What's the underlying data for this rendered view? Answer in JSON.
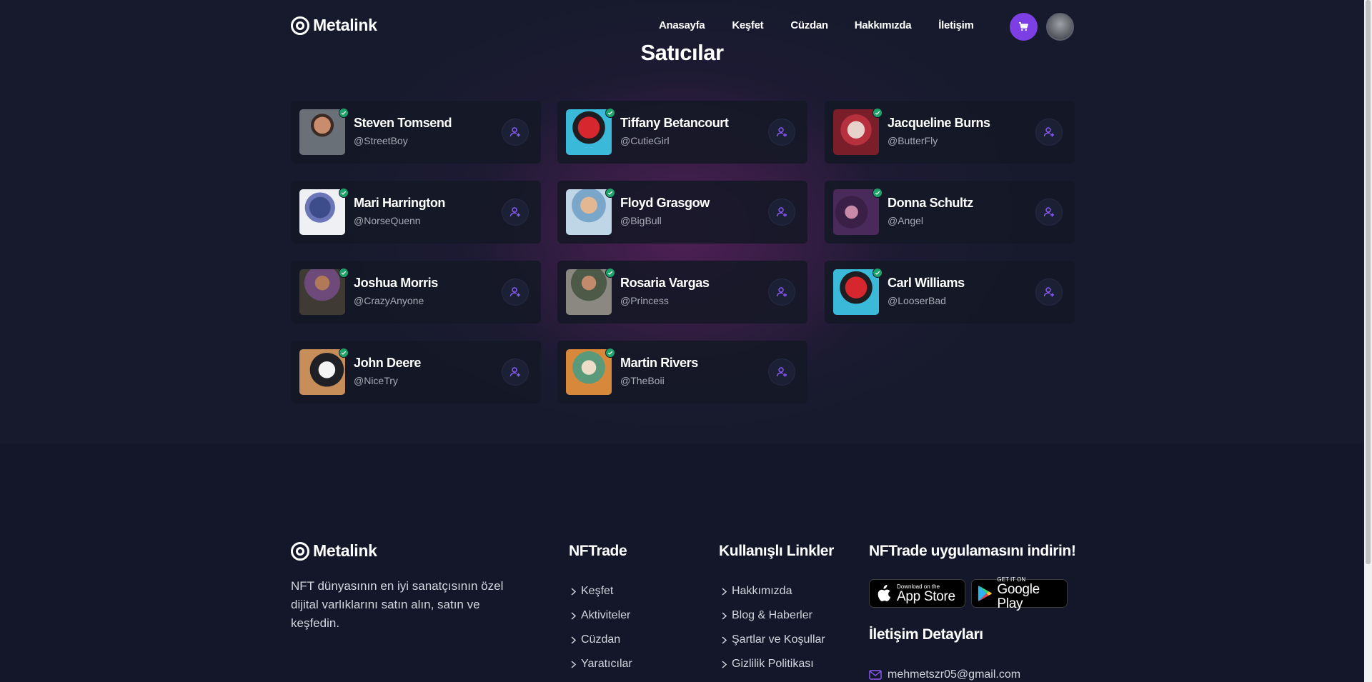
{
  "brand": {
    "name": "Metalink"
  },
  "nav": {
    "links": [
      "Anasayfa",
      "Keşfet",
      "Cüzdan",
      "Hakkımızda",
      "İletişim"
    ]
  },
  "colors": {
    "accent": "#7b3fe4",
    "verified": "#1ea46a",
    "background": "#14172a"
  },
  "sellers_section": {
    "title": "Satıcılar",
    "sellers": [
      {
        "name": "Steven Tomsend",
        "handle": "@StreetBoy"
      },
      {
        "name": "Tiffany Betancourt",
        "handle": "@CutieGirl"
      },
      {
        "name": "Jacqueline Burns",
        "handle": "@ButterFly"
      },
      {
        "name": "Mari Harrington",
        "handle": "@NorseQuenn"
      },
      {
        "name": "Floyd Grasgow",
        "handle": "@BigBull"
      },
      {
        "name": "Donna Schultz",
        "handle": "@Angel"
      },
      {
        "name": "Joshua Morris",
        "handle": "@CrazyAnyone"
      },
      {
        "name": "Rosaria Vargas",
        "handle": "@Princess"
      },
      {
        "name": "Carl Williams",
        "handle": "@LooserBad"
      },
      {
        "name": "John Deere",
        "handle": "@NiceTry"
      },
      {
        "name": "Martin Rivers",
        "handle": "@TheBoii"
      }
    ]
  },
  "footer": {
    "brand": "Metalink",
    "description": "NFT dünyasının en iyi sanatçısının özel dijital varlıklarını satın alın, satın ve keşfedin.",
    "nftrade": {
      "title": "NFTrade",
      "links": [
        "Keşfet",
        "Aktiviteler",
        "Cüzdan",
        "Yaratıcılar"
      ]
    },
    "useful_links": {
      "title": "Kullanışlı Linkler",
      "links": [
        "Hakkımızda",
        "Blog & Haberler",
        "Şartlar ve Koşullar",
        "Gizlilik Politikası"
      ]
    },
    "app": {
      "title": "NFTrade uygulamasını indirin!",
      "app_store_small": "Download on the",
      "app_store_big": "App Store",
      "google_play_small": "GET IT ON",
      "google_play_big": "Google Play"
    },
    "contact": {
      "title": "İletişim Detayları",
      "email": "mehmetszr05@gmail.com"
    }
  }
}
